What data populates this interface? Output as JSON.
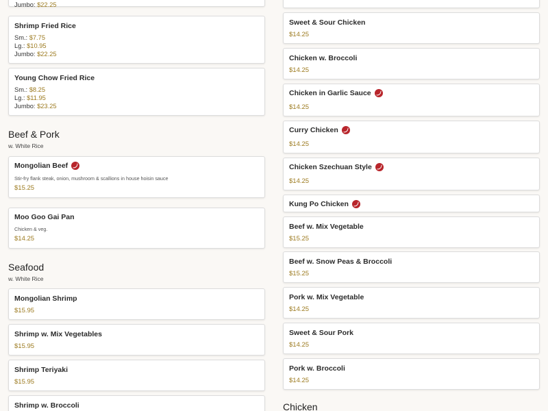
{
  "left": {
    "top_partial": {
      "label": "Jumbo:",
      "value": "$22.25"
    },
    "fried_rice": [
      {
        "name": "Shrimp Fried Rice",
        "options": [
          {
            "label": "Sm.:",
            "value": "$7.75"
          },
          {
            "label": "Lg.:",
            "value": "$10.95"
          },
          {
            "label": "Jumbo:",
            "value": "$22.25"
          }
        ]
      },
      {
        "name": "Young Chow Fried Rice",
        "options": [
          {
            "label": "Sm.:",
            "value": "$8.25"
          },
          {
            "label": "Lg.:",
            "value": "$11.95"
          },
          {
            "label": "Jumbo:",
            "value": "$23.25"
          }
        ]
      }
    ],
    "beef_pork": {
      "title": "Beef & Pork",
      "subtitle": "w. White Rice",
      "items": [
        {
          "name": "Mongolian Beef",
          "spicy": true,
          "desc": "Stir-fry flank steak, onion, mushroom & scallions in house hoisin sauce",
          "price": "$15.25"
        },
        {
          "name": "Moo Goo Gai Pan",
          "spicy": false,
          "desc": "Chicken & veg.",
          "price": "$14.25"
        }
      ]
    },
    "seafood": {
      "title": "Seafood",
      "subtitle": "w. White Rice",
      "items": [
        {
          "name": "Mongolian Shrimp",
          "price": "$15.95"
        },
        {
          "name": "Shrimp w. Mix Vegetables",
          "price": "$15.95"
        },
        {
          "name": "Shrimp Teriyaki",
          "price": "$15.95"
        },
        {
          "name": "Shrimp w. Broccoli",
          "price": ""
        }
      ]
    }
  },
  "right": {
    "items": [
      {
        "name": "Sweet & Sour Chicken",
        "spicy": false,
        "price": "$14.25"
      },
      {
        "name": "Chicken w. Broccoli",
        "spicy": false,
        "price": "$14.25"
      },
      {
        "name": "Chicken in Garlic Sauce",
        "spicy": true,
        "price": "$14.25"
      },
      {
        "name": "Curry Chicken",
        "spicy": true,
        "price": "$14.25"
      },
      {
        "name": "Chicken Szechuan Style",
        "spicy": true,
        "price": "$14.25"
      },
      {
        "name": "Kung Po Chicken",
        "spicy": true,
        "price": ""
      },
      {
        "name": "Beef w. Mix Vegetable",
        "spicy": false,
        "price": "$15.25"
      },
      {
        "name": "Beef w. Snow Peas & Broccoli",
        "spicy": false,
        "price": "$15.25"
      },
      {
        "name": "Pork w. Mix Vegetable",
        "spicy": false,
        "price": "$14.25"
      },
      {
        "name": "Sweet & Sour Pork",
        "spicy": false,
        "price": "$14.25"
      },
      {
        "name": "Pork w. Broccoli",
        "spicy": false,
        "price": "$14.25"
      }
    ],
    "next_section_title": "Chicken"
  },
  "colors": {
    "price": "#9c7a1f",
    "spicy_icon": "#b8252b",
    "background": "#faf8f5"
  },
  "icons": {
    "spicy": "chili-pepper-icon"
  }
}
